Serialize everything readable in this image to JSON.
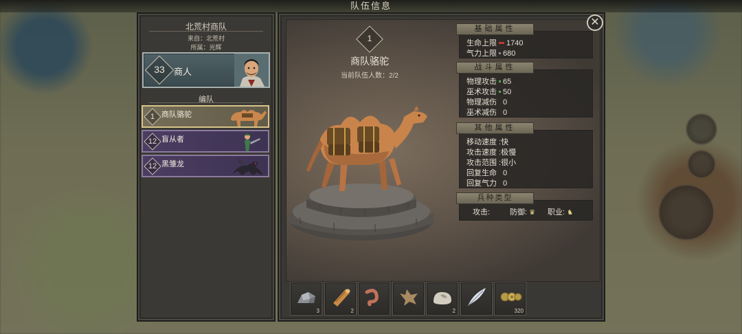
{
  "dialog": {
    "title": "队伍信息"
  },
  "left_panel": {
    "caravan_name": "北荒村商队",
    "origin": "来自：北荒村",
    "faction": "所属：光辉",
    "leader": {
      "level": "33",
      "class": "商人"
    },
    "formation_label": "编队",
    "units": [
      {
        "level": "1",
        "name": "商队骆驼",
        "selected": true
      },
      {
        "level": "12",
        "name": "盲从者",
        "selected": false
      },
      {
        "level": "12",
        "name": "黑雏龙",
        "selected": false
      }
    ]
  },
  "unit_detail": {
    "level": "1",
    "name": "商队骆驼",
    "party_count": "当前队伍人数：2/2"
  },
  "stats": {
    "basic": {
      "header": "基础属性",
      "hp_label": "生命上限",
      "hp_value": "1740",
      "mp_label": "气力上限",
      "mp_value": "680"
    },
    "combat": {
      "header": "战斗属性",
      "phys_atk_label": "物理攻击",
      "phys_atk_value": "65",
      "mag_atk_label": "巫术攻击",
      "mag_atk_value": "50",
      "phys_red_label": "物理减伤",
      "phys_red_value": "0",
      "mag_red_label": "巫术减伤",
      "mag_red_value": "0"
    },
    "other": {
      "header": "其他属性",
      "move_speed": "移动速度 :快",
      "atk_speed": "攻击速度 :极慢",
      "atk_range": "攻击范围 :很小",
      "hp_regen_label": "回复生命",
      "hp_regen_value": "0",
      "mp_regen_label": "回复气力",
      "mp_regen_value": "0"
    },
    "troop_type": {
      "header": "兵种类型",
      "attack": "攻击:",
      "defense": "防御:",
      "profession": "职业:"
    }
  },
  "inventory": [
    {
      "item": "iron-ore-icon",
      "qty": "3"
    },
    {
      "item": "wood-log-icon",
      "qty": "2"
    },
    {
      "item": "worm-icon",
      "qty": ""
    },
    {
      "item": "hide-icon",
      "qty": ""
    },
    {
      "item": "stone-icon",
      "qty": "2"
    },
    {
      "item": "feather-icon",
      "qty": ""
    },
    {
      "item": "coins-icon",
      "qty": "320"
    }
  ],
  "colors": {
    "selected_border": "#d8c58a",
    "unit_row_purple": "#4b3d62",
    "stat_header": "#8b8470",
    "hp_pip": "#c0392b",
    "atk_pip": "#4caf50"
  }
}
